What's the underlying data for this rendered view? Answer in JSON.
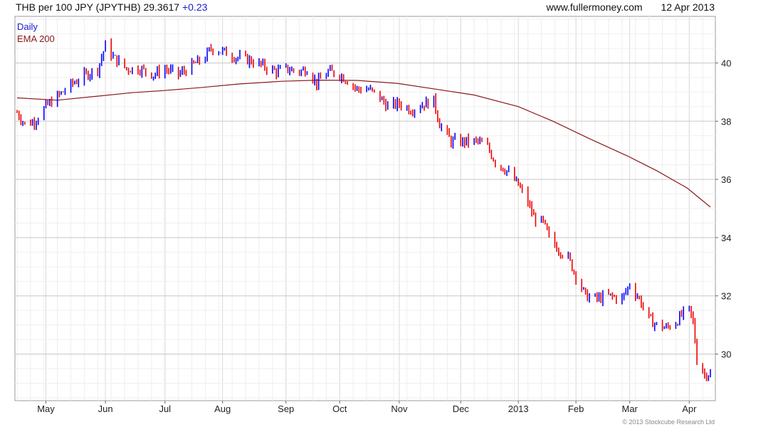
{
  "header": {
    "instrument": "THB per 100 JPY (JPYTHB)",
    "last": "29.3617",
    "change": "+0.23",
    "site": "www.fullermoney.com",
    "date": "12 Apr 2013"
  },
  "legend": {
    "daily": "Daily",
    "ema": "EMA 200"
  },
  "footer": "© 2013 Stockcube Research Ltd",
  "colors": {
    "up": "#0000ff",
    "down": "#ee0000",
    "ema": "#8b1a1a",
    "grid": "#d8d8d8"
  },
  "chart_data": {
    "type": "line",
    "title": "THB per 100 JPY (JPYTHB)",
    "xlabel": "",
    "ylabel": "",
    "ylim": [
      28.4,
      41.6
    ],
    "grid": true,
    "legend": "top-left",
    "y_ticks": [
      30,
      32,
      34,
      36,
      38,
      40
    ],
    "x_tick_labels": [
      "May",
      "Jun",
      "Jul",
      "Aug",
      "Sep",
      "Oct",
      "Nov",
      "Dec",
      "2013",
      "Feb",
      "Mar",
      "Apr"
    ],
    "x_tick_dates": [
      "2012-05-01",
      "2012-06-01",
      "2012-07-02",
      "2012-08-01",
      "2012-09-03",
      "2012-10-01",
      "2012-11-01",
      "2012-12-03",
      "2013-01-02",
      "2013-02-01",
      "2013-03-01",
      "2013-04-01"
    ],
    "x_range": [
      "2012-04-16",
      "2013-04-12"
    ],
    "series": [
      {
        "name": "Daily",
        "points": [
          [
            "2012-04-16",
            38.3
          ],
          [
            "2012-04-20",
            37.9
          ],
          [
            "2012-04-25",
            38.0
          ],
          [
            "2012-05-01",
            38.5
          ],
          [
            "2012-05-08",
            38.9
          ],
          [
            "2012-05-15",
            39.3
          ],
          [
            "2012-05-22",
            39.6
          ],
          [
            "2012-05-28",
            39.8
          ],
          [
            "2012-06-01",
            40.6
          ],
          [
            "2012-06-05",
            40.2
          ],
          [
            "2012-06-12",
            39.8
          ],
          [
            "2012-06-19",
            39.8
          ],
          [
            "2012-06-26",
            39.6
          ],
          [
            "2012-07-02",
            39.8
          ],
          [
            "2012-07-09",
            39.6
          ],
          [
            "2012-07-16",
            39.9
          ],
          [
            "2012-07-23",
            40.2
          ],
          [
            "2012-07-26",
            40.5
          ],
          [
            "2012-08-01",
            40.4
          ],
          [
            "2012-08-08",
            40.2
          ],
          [
            "2012-08-15",
            40.1
          ],
          [
            "2012-08-22",
            39.9
          ],
          [
            "2012-08-29",
            39.7
          ],
          [
            "2012-09-03",
            39.8
          ],
          [
            "2012-09-10",
            39.7
          ],
          [
            "2012-09-14",
            39.8
          ],
          [
            "2012-09-19",
            39.3
          ],
          [
            "2012-09-25",
            39.7
          ],
          [
            "2012-10-01",
            39.6
          ],
          [
            "2012-10-05",
            39.4
          ],
          [
            "2012-10-10",
            39.1
          ],
          [
            "2012-10-16",
            39.1
          ],
          [
            "2012-10-22",
            38.8
          ],
          [
            "2012-10-26",
            38.5
          ],
          [
            "2012-11-01",
            38.6
          ],
          [
            "2012-11-07",
            38.4
          ],
          [
            "2012-11-14",
            38.6
          ],
          [
            "2012-11-19",
            38.7
          ],
          [
            "2012-11-22",
            37.9
          ],
          [
            "2012-11-28",
            37.3
          ],
          [
            "2012-12-03",
            37.3
          ],
          [
            "2012-12-07",
            37.3
          ],
          [
            "2012-12-12",
            37.3
          ],
          [
            "2012-12-17",
            37.1
          ],
          [
            "2012-12-21",
            36.6
          ],
          [
            "2012-12-27",
            36.3
          ],
          [
            "2013-01-02",
            35.8
          ],
          [
            "2013-01-07",
            35.2
          ],
          [
            "2013-01-10",
            34.7
          ],
          [
            "2013-01-15",
            34.5
          ],
          [
            "2013-01-18",
            34.0
          ],
          [
            "2013-01-23",
            33.6
          ],
          [
            "2013-01-28",
            33.3
          ],
          [
            "2013-02-01",
            32.7
          ],
          [
            "2013-02-06",
            32.0
          ],
          [
            "2013-02-12",
            31.9
          ],
          [
            "2013-02-18",
            32.0
          ],
          [
            "2013-02-25",
            31.9
          ],
          [
            "2013-03-01",
            32.4
          ],
          [
            "2013-03-06",
            31.9
          ],
          [
            "2013-03-11",
            31.2
          ],
          [
            "2013-03-15",
            31.0
          ],
          [
            "2013-03-20",
            30.9
          ],
          [
            "2013-03-25",
            31.1
          ],
          [
            "2013-03-29",
            31.4
          ],
          [
            "2013-04-01",
            31.5
          ],
          [
            "2013-04-03",
            31.1
          ],
          [
            "2013-04-05",
            29.8
          ],
          [
            "2013-04-09",
            29.3
          ],
          [
            "2013-04-12",
            29.36
          ]
        ]
      },
      {
        "name": "EMA 200",
        "points": [
          [
            "2012-04-16",
            38.8
          ],
          [
            "2012-05-07",
            38.72
          ],
          [
            "2012-05-28",
            38.86
          ],
          [
            "2012-06-15",
            38.98
          ],
          [
            "2012-07-01",
            39.05
          ],
          [
            "2012-07-20",
            39.15
          ],
          [
            "2012-08-10",
            39.28
          ],
          [
            "2012-09-01",
            39.37
          ],
          [
            "2012-09-20",
            39.41
          ],
          [
            "2012-10-10",
            39.4
          ],
          [
            "2012-10-31",
            39.3
          ],
          [
            "2012-11-20",
            39.1
          ],
          [
            "2012-12-10",
            38.9
          ],
          [
            "2013-01-02",
            38.5
          ],
          [
            "2013-01-20",
            38.0
          ],
          [
            "2013-02-08",
            37.4
          ],
          [
            "2013-02-28",
            36.8
          ],
          [
            "2013-03-15",
            36.3
          ],
          [
            "2013-03-31",
            35.7
          ],
          [
            "2013-04-12",
            35.05
          ]
        ]
      }
    ]
  }
}
